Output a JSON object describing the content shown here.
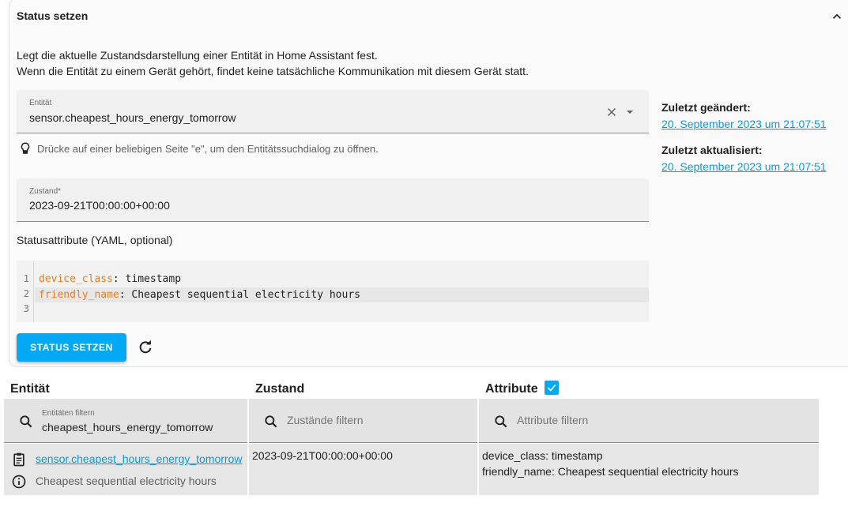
{
  "card": {
    "title": "Status setzen",
    "description_line1": "Legt die aktuelle Zustandsdarstellung einer Entität in Home Assistant fest.",
    "description_line2": "Wenn die Entität zu einem Gerät gehört, findet keine tatsächliche Kommunikation mit diesem Gerät statt.",
    "entity_label": "Entität",
    "entity_value": "sensor.cheapest_hours_energy_tomorrow",
    "hint": "Drücke auf einer beliebigen Seite \"e\", um den Entitätssuchdialog zu öffnen.",
    "state_label": "Zustand*",
    "state_value": "2023-09-21T00:00:00+00:00",
    "attributes_label": "Statusattribute (YAML, optional)",
    "code_lines": [
      {
        "num": "1",
        "key": "device_class",
        "value": ": timestamp"
      },
      {
        "num": "2",
        "key": "friendly_name",
        "value": ": Cheapest sequential electricity hours"
      },
      {
        "num": "3",
        "key": "",
        "value": ""
      }
    ],
    "submit_label": "STATUS SETZEN",
    "last_changed_label": "Zuletzt geändert:",
    "last_changed_value": "20. September 2023 um 21:07:51",
    "last_updated_label": "Zuletzt aktualisiert:",
    "last_updated_value": "20. September 2023 um 21:07:51"
  },
  "table": {
    "headers": {
      "entity": "Entität",
      "state": "Zustand",
      "attributes": "Attribute"
    },
    "attributes_checked": true,
    "filters": {
      "entity_label": "Entitäten filtern",
      "entity_value": "cheapest_hours_energy_tomorrow",
      "state_placeholder": "Zustände filtern",
      "attributes_placeholder": "Attribute filtern"
    },
    "rows": [
      {
        "entity_id": "sensor.cheapest_hours_energy_tomorrow",
        "friendly_name": "Cheapest sequential electricity hours",
        "state": "2023-09-21T00:00:00+00:00",
        "attr_line1": "device_class: timestamp",
        "attr_line2": "friendly_name: Cheapest sequential electricity hours"
      }
    ]
  },
  "colors": {
    "accent": "#03a9f4",
    "link": "#039be5",
    "yaml_key": "#e67e22"
  }
}
